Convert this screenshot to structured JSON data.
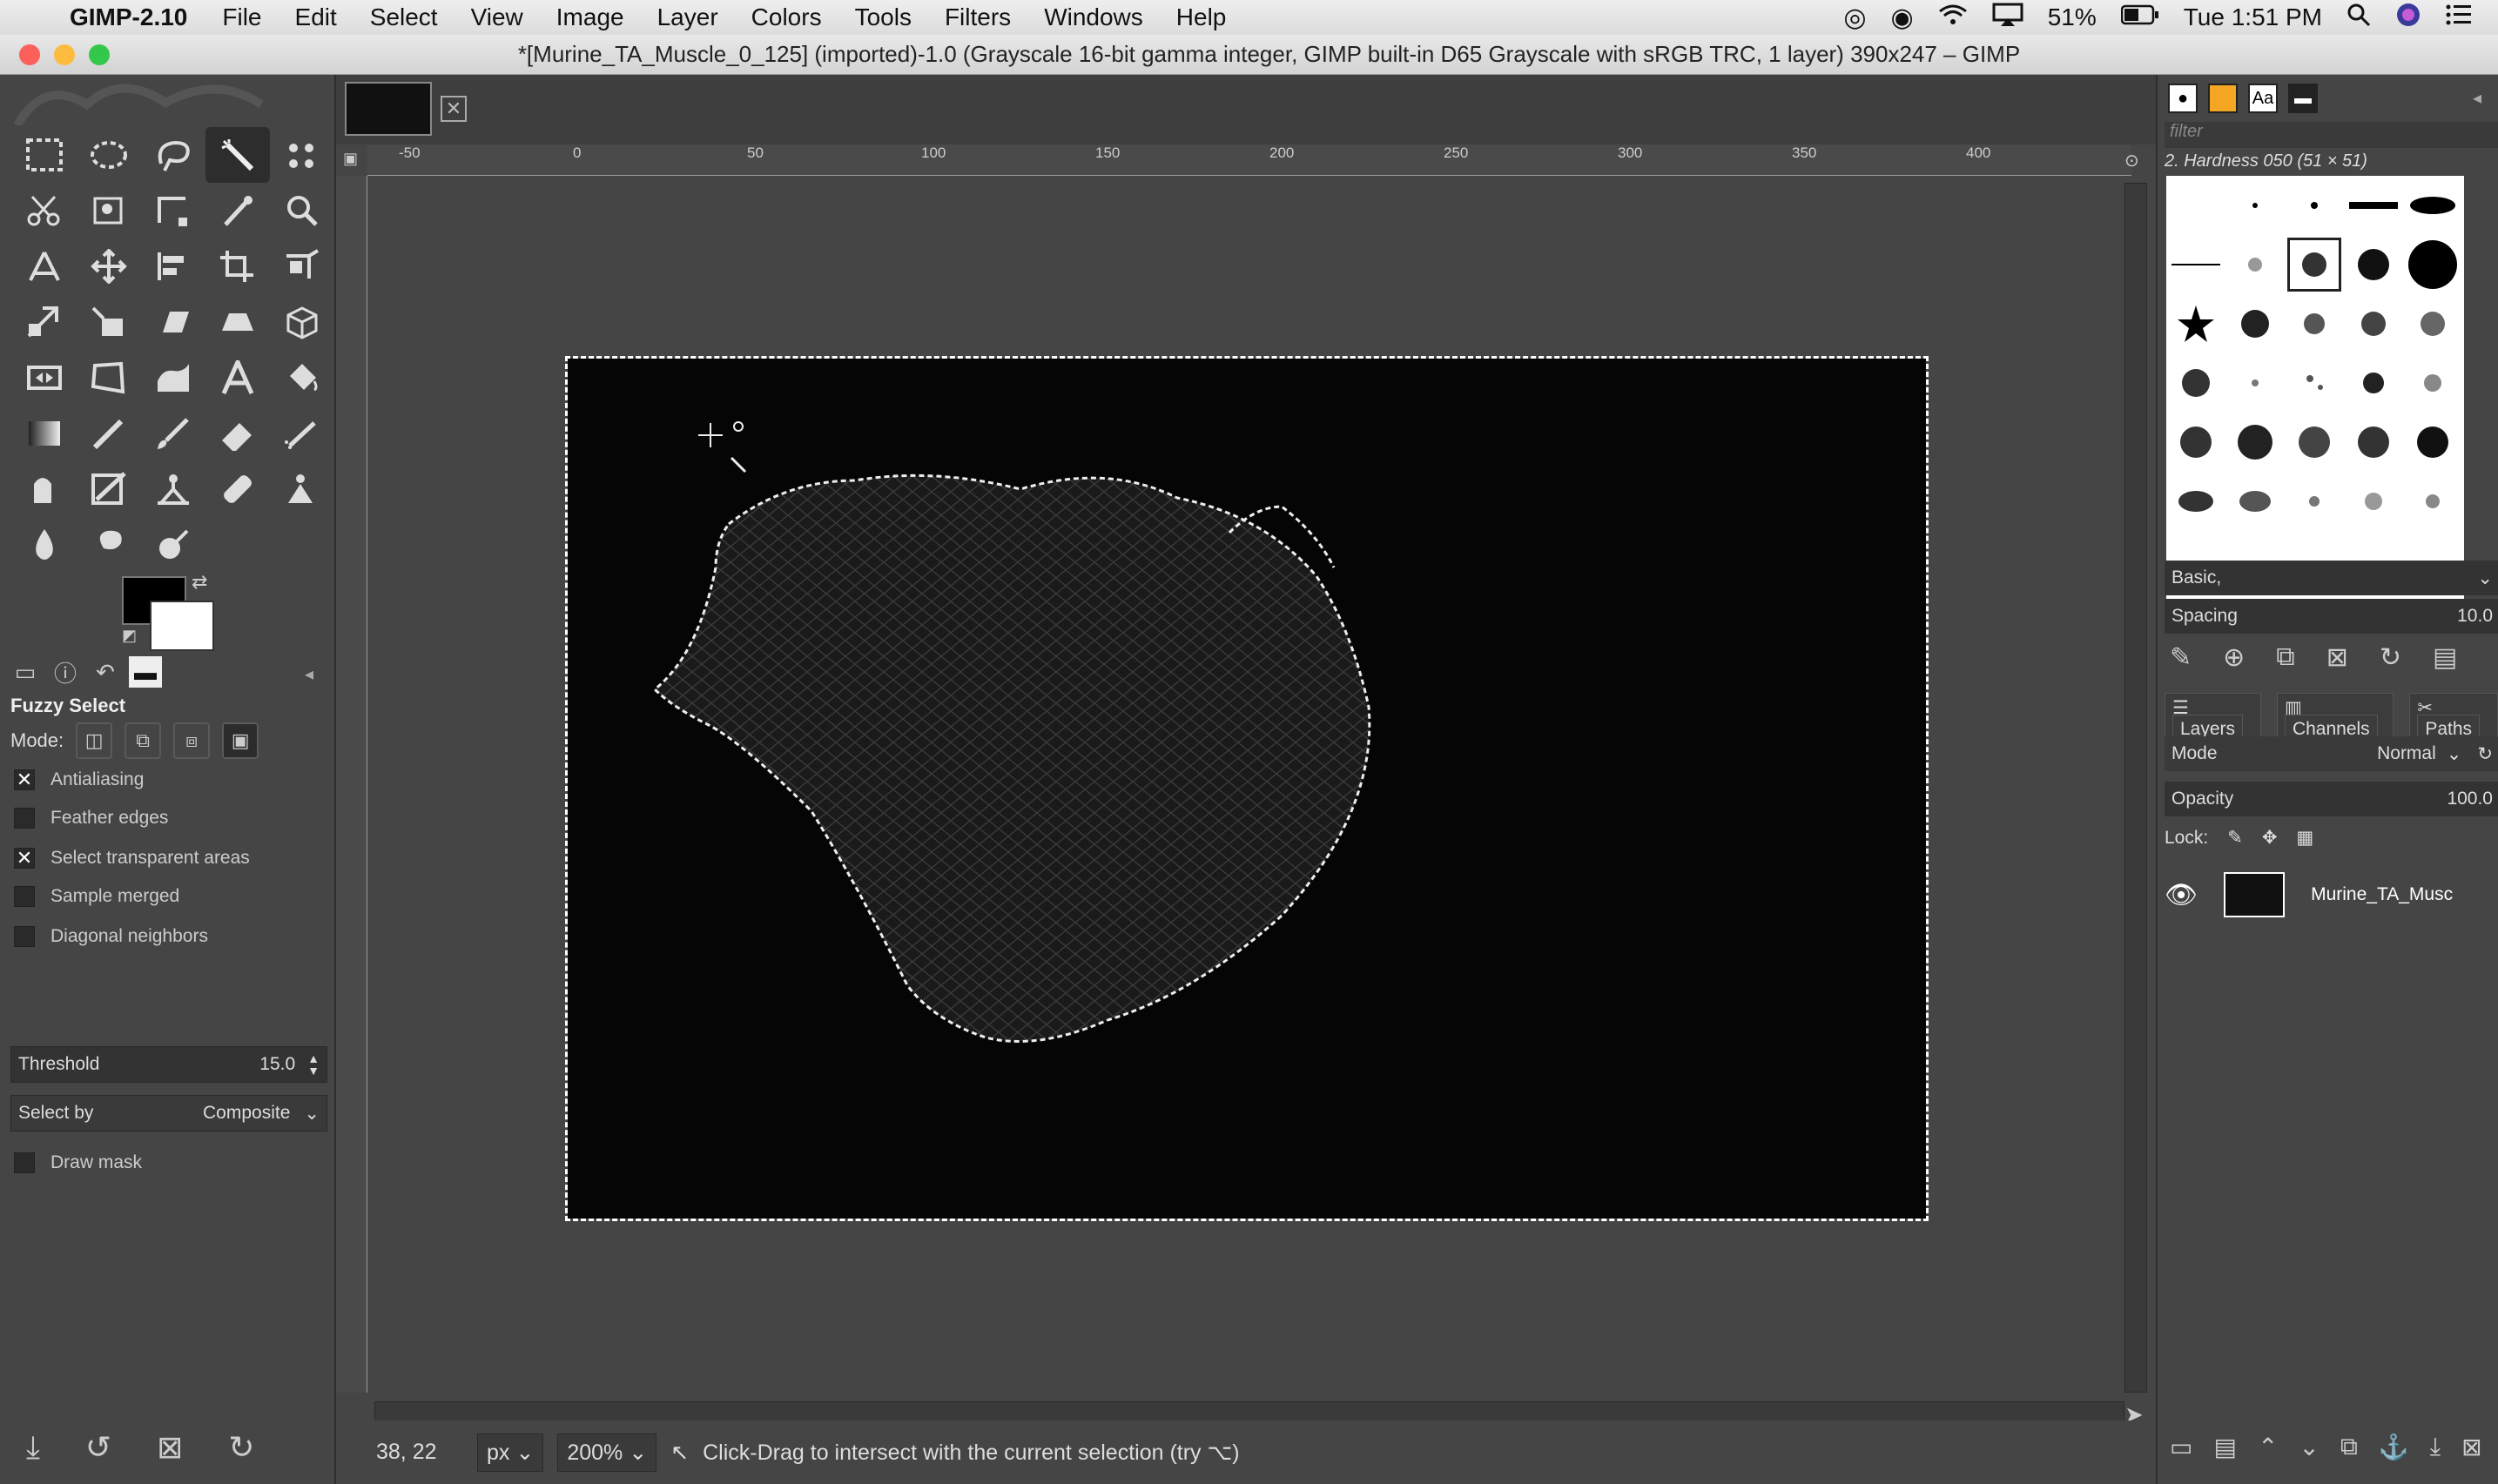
{
  "menubar": {
    "app_name": "GIMP-2.10",
    "items": [
      "File",
      "Edit",
      "Select",
      "View",
      "Image",
      "Layer",
      "Colors",
      "Tools",
      "Filters",
      "Windows",
      "Help"
    ],
    "battery": "51%",
    "clock": "Tue 1:51 PM"
  },
  "window": {
    "title": "*[Murine_TA_Muscle_0_125] (imported)-1.0 (Grayscale 16-bit gamma integer, GIMP built-in D65 Grayscale with sRGB TRC, 1 layer) 390x247 – GIMP"
  },
  "tool_options": {
    "title": "Fuzzy Select",
    "mode_label": "Mode:",
    "antialiasing": "Antialiasing",
    "feather_edges": "Feather edges",
    "select_transparent": "Select transparent areas",
    "sample_merged": "Sample merged",
    "diagonal_neighbors": "Diagonal neighbors",
    "threshold_label": "Threshold",
    "threshold_value": "15.0",
    "select_by_label": "Select by",
    "select_by_value": "Composite",
    "draw_mask": "Draw mask",
    "checked": {
      "antialiasing": true,
      "select_transparent": true,
      "feather_edges": false,
      "sample_merged": false,
      "diagonal_neighbors": false,
      "draw_mask": false
    }
  },
  "rulers": {
    "h_labels": [
      "-50",
      "0",
      "50",
      "100",
      "150",
      "200",
      "250",
      "300",
      "350",
      "400"
    ]
  },
  "status": {
    "coords": "38, 22",
    "unit": "px",
    "zoom": "200%",
    "message": "Click-Drag to intersect with the current selection (try ⌥)"
  },
  "brushes": {
    "filter_placeholder": "filter",
    "current": "2. Hardness 050 (51 × 51)",
    "preset": "Basic,",
    "spacing_label": "Spacing",
    "spacing_value": "10.0"
  },
  "layers": {
    "tabs": [
      "Layers",
      "Channels",
      "Paths"
    ],
    "mode_label": "Mode",
    "mode_value": "Normal",
    "opacity_label": "Opacity",
    "opacity_value": "100.0",
    "lock_label": "Lock:",
    "layer_name": "Murine_TA_Musc"
  },
  "colors": {
    "accent": "#454545",
    "image_bg": "#050505"
  }
}
